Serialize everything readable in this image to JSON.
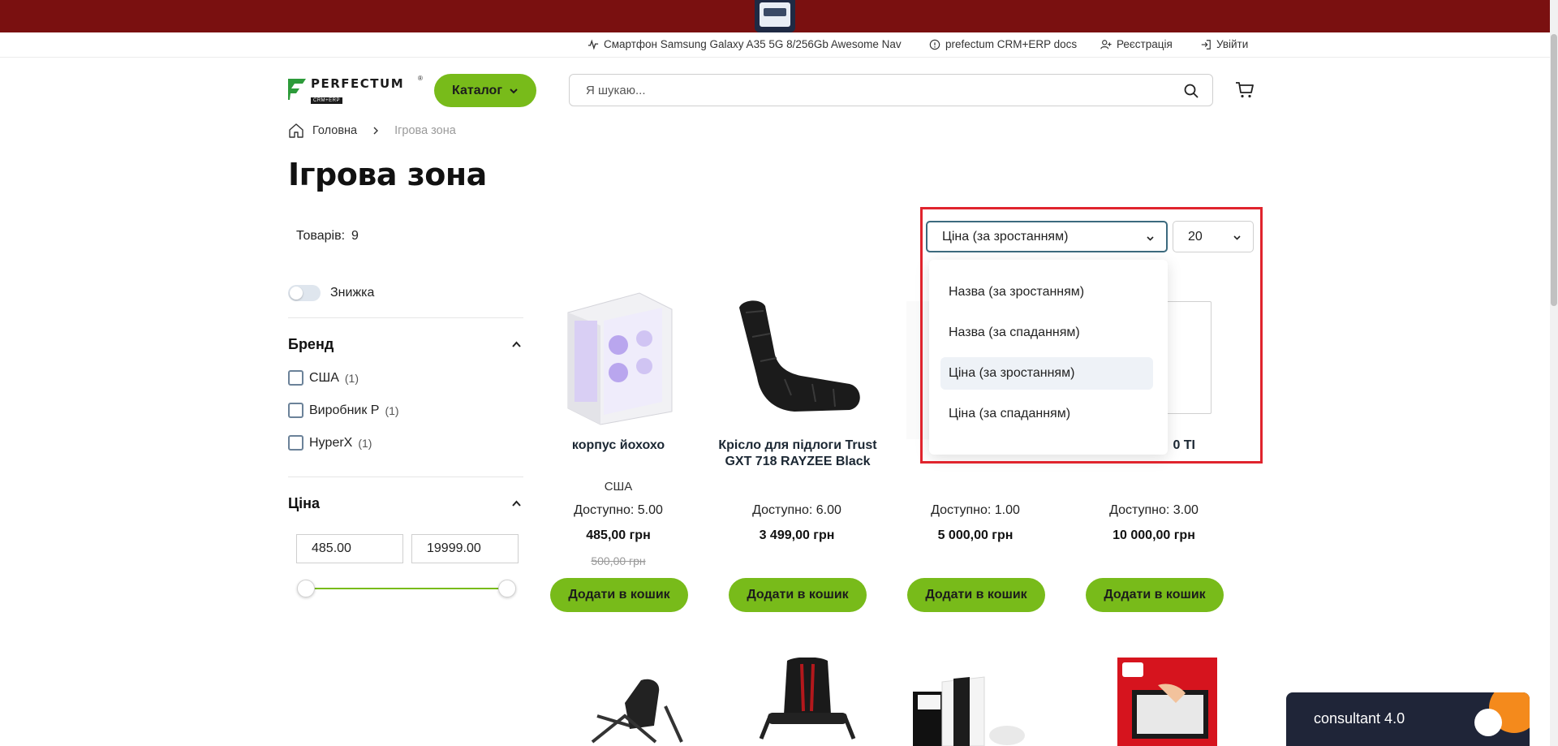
{
  "colors": {
    "banner": "#7a1010",
    "accent": "#78bb1a",
    "highlight": "#e0242d",
    "widget": "#1f2538",
    "widget_accent": "#f48a1c"
  },
  "topnav": {
    "product_link": "Смартфон Samsung Galaxy A35 5G 8/256Gb Awesome Nav",
    "docs_link": "prefectum CRM+ERP docs",
    "register": "Реєстрація",
    "login": "Увійти"
  },
  "header": {
    "logo_text": "PERFECTUM",
    "logo_sub": "CRM+ERP",
    "logo_reg": "®",
    "catalog_label": "Каталог",
    "search_placeholder": "Я шукаю..."
  },
  "breadcrumb": {
    "home": "Головна",
    "current": "Ігрова зона"
  },
  "page_title": "Ігрова зона",
  "count": {
    "label": "Товарів:",
    "value": "9"
  },
  "sort": {
    "selected": "Ціна (за зростанням)",
    "per_page": "20",
    "options": [
      "Назва (за зростанням)",
      "Назва (за спаданням)",
      "Ціна (за зростанням)",
      "Ціна (за спаданням)"
    ]
  },
  "sidebar": {
    "discount_label": "Знижка",
    "brand_title": "Бренд",
    "brands": [
      {
        "name": "США",
        "count": "(1)"
      },
      {
        "name": "Виробник Р",
        "count": "(1)"
      },
      {
        "name": "HyperX",
        "count": "(1)"
      }
    ],
    "price_title": "Ціна",
    "price_min": "485.00",
    "price_max": "19999.00"
  },
  "products": [
    {
      "name": "корпус йохохо",
      "brand": "США",
      "stock": "Доступно: 5.00",
      "price": "485,00 грн",
      "old_price": "500,00 грн",
      "button": "Додати в кошик"
    },
    {
      "name": "Крісло для підлоги Trust GXT 718 RAYZEE Black",
      "stock": "Доступно: 6.00",
      "price": "3 499,00 грн",
      "button": "Додати в кошик"
    },
    {
      "stock": "Доступно: 1.00",
      "price": "5 000,00 грн",
      "button": "Додати в кошик"
    },
    {
      "name_fragment": "0 TI",
      "stock": "Доступно: 3.00",
      "price": "10 000,00 грн",
      "button": "Додати в кошик"
    }
  ],
  "consultant": {
    "label": "consultant 4.0"
  }
}
